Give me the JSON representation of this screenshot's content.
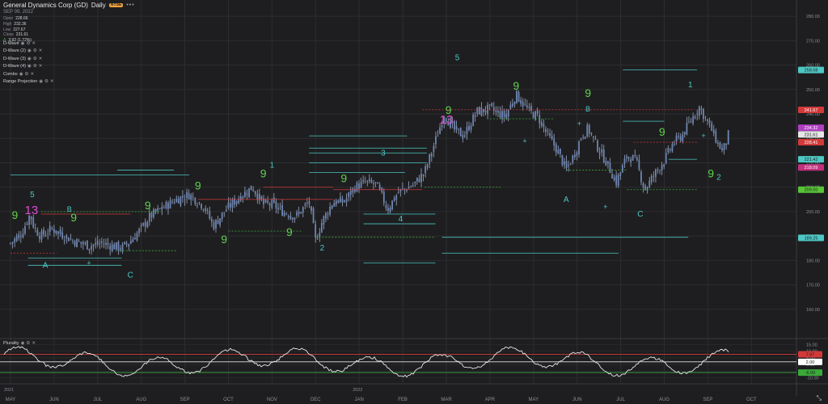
{
  "header": {
    "title": "General Dynamics Corp (GD)",
    "interval": "Daily",
    "badge": "NYSE",
    "date": "SEP 09, 2022",
    "open_label": "Open",
    "open": "228.66",
    "high_label": "High",
    "high": "232.36",
    "low_label": "Low",
    "low": "227.67",
    "close_label": "Close",
    "close": "231.61",
    "change_label": "Δ",
    "change": "3.92 (1.72%)"
  },
  "studies": [
    {
      "label": "D-Wave"
    },
    {
      "label": "D-Wave (2)"
    },
    {
      "label": "D-Wave (3)"
    },
    {
      "label": "D-Wave (4)"
    },
    {
      "label": "Combo"
    },
    {
      "label": "Range Projection"
    }
  ],
  "lower_panel": {
    "label": "Plurality"
  },
  "colors": {
    "background": "#1e1e20",
    "grid": "#2c2d31",
    "candle": "#6e86b3",
    "wick": "#9aa7c2",
    "nine": "#5fd24d",
    "thirteen": "#e04bd6",
    "wave": "#4dc7c4",
    "red_line": "#d23a3a",
    "green_line": "#3aaa3a",
    "osc": "#e6e6e6"
  },
  "chart_data": [
    {
      "type": "candlestick",
      "title": "General Dynamics Corp (GD) Daily",
      "x_ticks": [
        "MAY",
        "JUN",
        "JUL",
        "AUG",
        "SEP",
        "OCT",
        "NOV",
        "DEC",
        "JAN",
        "FEB",
        "MAR",
        "APR",
        "MAY",
        "JUN",
        "JUL",
        "AUG",
        "SEP",
        "OCT"
      ],
      "year_labels": [
        {
          "at": "MAY",
          "text": "2021"
        },
        {
          "at": "JAN",
          "text": "2022"
        }
      ],
      "ylim": [
        150,
        285
      ],
      "y_ticks": [
        280,
        270,
        260,
        250,
        240,
        230,
        220,
        210,
        200,
        190,
        180,
        170,
        160
      ],
      "close_path": [
        {
          "m": 0.0,
          "v": 187
        },
        {
          "m": 0.25,
          "v": 191
        },
        {
          "m": 0.45,
          "v": 199
        },
        {
          "m": 0.55,
          "v": 193
        },
        {
          "m": 0.7,
          "v": 190
        },
        {
          "m": 0.95,
          "v": 193
        },
        {
          "m": 1.15,
          "v": 191
        },
        {
          "m": 1.45,
          "v": 188
        },
        {
          "m": 1.8,
          "v": 186
        },
        {
          "m": 2.1,
          "v": 187
        },
        {
          "m": 2.55,
          "v": 185
        },
        {
          "m": 2.75,
          "v": 188
        },
        {
          "m": 3.0,
          "v": 193
        },
        {
          "m": 3.2,
          "v": 198
        },
        {
          "m": 3.45,
          "v": 201
        },
        {
          "m": 3.8,
          "v": 205
        },
        {
          "m": 4.1,
          "v": 207
        },
        {
          "m": 4.45,
          "v": 202
        },
        {
          "m": 4.65,
          "v": 194
        },
        {
          "m": 4.95,
          "v": 201
        },
        {
          "m": 5.25,
          "v": 206
        },
        {
          "m": 5.55,
          "v": 210
        },
        {
          "m": 5.8,
          "v": 203
        },
        {
          "m": 6.0,
          "v": 203
        },
        {
          "m": 6.25,
          "v": 200
        },
        {
          "m": 6.55,
          "v": 198
        },
        {
          "m": 6.85,
          "v": 204
        },
        {
          "m": 7.0,
          "v": 188
        },
        {
          "m": 7.15,
          "v": 196
        },
        {
          "m": 7.4,
          "v": 204
        },
        {
          "m": 7.65,
          "v": 204
        },
        {
          "m": 7.9,
          "v": 210
        },
        {
          "m": 8.15,
          "v": 212
        },
        {
          "m": 8.4,
          "v": 211
        },
        {
          "m": 8.65,
          "v": 201
        },
        {
          "m": 8.9,
          "v": 208
        },
        {
          "m": 9.25,
          "v": 211
        },
        {
          "m": 9.5,
          "v": 216
        },
        {
          "m": 9.75,
          "v": 229
        },
        {
          "m": 9.95,
          "v": 240
        },
        {
          "m": 10.15,
          "v": 234
        },
        {
          "m": 10.4,
          "v": 231
        },
        {
          "m": 10.7,
          "v": 241
        },
        {
          "m": 11.0,
          "v": 242
        },
        {
          "m": 11.35,
          "v": 239
        },
        {
          "m": 11.6,
          "v": 248
        },
        {
          "m": 11.9,
          "v": 241
        },
        {
          "m": 12.1,
          "v": 239
        },
        {
          "m": 12.3,
          "v": 232
        },
        {
          "m": 12.55,
          "v": 225
        },
        {
          "m": 12.75,
          "v": 217
        },
        {
          "m": 12.95,
          "v": 224
        },
        {
          "m": 13.1,
          "v": 231
        },
        {
          "m": 13.25,
          "v": 234
        },
        {
          "m": 13.45,
          "v": 227
        },
        {
          "m": 13.65,
          "v": 221
        },
        {
          "m": 13.9,
          "v": 212
        },
        {
          "m": 14.15,
          "v": 223
        },
        {
          "m": 14.35,
          "v": 221
        },
        {
          "m": 14.55,
          "v": 209
        },
        {
          "m": 14.8,
          "v": 216
        },
        {
          "m": 15.0,
          "v": 221
        },
        {
          "m": 15.2,
          "v": 228
        },
        {
          "m": 15.4,
          "v": 231
        },
        {
          "m": 15.6,
          "v": 237
        },
        {
          "m": 15.8,
          "v": 243
        },
        {
          "m": 15.95,
          "v": 238
        },
        {
          "m": 16.1,
          "v": 233
        },
        {
          "m": 16.25,
          "v": 227
        },
        {
          "m": 16.35,
          "v": 225
        },
        {
          "m": 16.48,
          "v": 232
        }
      ],
      "price_labels": [
        {
          "text": "258.08",
          "v": 258,
          "color": "#4dc7c4"
        },
        {
          "text": "241.67",
          "v": 241.67,
          "color": "#d23a3a"
        },
        {
          "text": "234.32",
          "v": 234.32,
          "color": "#b13fc4"
        },
        {
          "text": "231.61",
          "v": 231.61,
          "color": "#e6e6e6"
        },
        {
          "text": "228.41",
          "v": 228.41,
          "color": "#d23a3a"
        },
        {
          "text": "221.42",
          "v": 221.42,
          "color": "#4dc7c4"
        },
        {
          "text": "218.09",
          "v": 218.09,
          "color": "#c2307e"
        },
        {
          "text": "209.00",
          "v": 209,
          "color": "#58c437"
        },
        {
          "text": "189.25",
          "v": 189.25,
          "color": "#4dc7c4"
        }
      ],
      "levels": [
        {
          "from": 0.0,
          "to": 4.1,
          "v": 215,
          "color": "#4dc7c4"
        },
        {
          "from": 2.45,
          "to": 3.75,
          "v": 217,
          "color": "#4dc7c4"
        },
        {
          "from": 6.85,
          "to": 9.05,
          "v": 216,
          "color": "#4dc7c4"
        },
        {
          "from": 6.85,
          "to": 9.55,
          "v": 220,
          "color": "#4dc7c4"
        },
        {
          "from": 6.85,
          "to": 9.55,
          "v": 224,
          "color": "#4dc7c4"
        },
        {
          "from": 6.85,
          "to": 9.55,
          "v": 226,
          "color": "#4dc7c4"
        },
        {
          "from": 6.85,
          "to": 9.1,
          "v": 231,
          "color": "#4dc7c4"
        },
        {
          "from": 8.1,
          "to": 9.75,
          "v": 199,
          "color": "#4dc7c4"
        },
        {
          "from": 8.1,
          "to": 9.75,
          "v": 195,
          "color": "#4dc7c4"
        },
        {
          "from": 8.1,
          "to": 9.75,
          "v": 179,
          "color": "#4dc7c4"
        },
        {
          "from": 9.9,
          "to": 15.55,
          "v": 189.5,
          "color": "#4dc7c4"
        },
        {
          "from": 9.9,
          "to": 13.95,
          "v": 183,
          "color": "#4dc7c4"
        },
        {
          "from": 14.05,
          "to": 15.75,
          "v": 258,
          "color": "#4dc7c4"
        },
        {
          "from": 14.05,
          "to": 15.0,
          "v": 237,
          "color": "#4dc7c4"
        },
        {
          "from": 0.4,
          "to": 2.55,
          "v": 181,
          "color": "#4dc7c4"
        },
        {
          "from": 0.4,
          "to": 2.55,
          "v": 178,
          "color": "#4dc7c4"
        },
        {
          "from": 15.1,
          "to": 15.75,
          "v": 221.4,
          "color": "#4dc7c4"
        },
        {
          "from": 0.7,
          "to": 2.75,
          "v": 199,
          "color": "#d23a3a"
        },
        {
          "from": 4.3,
          "to": 7.4,
          "v": 205,
          "color": "#d23a3a"
        },
        {
          "from": 5.8,
          "to": 7.4,
          "v": 210,
          "color": "#d23a3a"
        },
        {
          "from": 7.4,
          "to": 9.45,
          "v": 209,
          "color": "#d23a3a"
        },
        {
          "from": 9.45,
          "to": 15.7,
          "v": 241.7,
          "color": "#d23a3a",
          "dash": true
        },
        {
          "from": 14.3,
          "to": 15.75,
          "v": 228.4,
          "color": "#d23a3a",
          "dash": true
        },
        {
          "from": 0.0,
          "to": 1.05,
          "v": 183,
          "color": "#d23a3a",
          "dash": true
        },
        {
          "from": 2.5,
          "to": 3.8,
          "v": 184,
          "color": "#3aaa3a",
          "dash": true
        },
        {
          "from": 5.0,
          "to": 6.7,
          "v": 192,
          "color": "#3aaa3a",
          "dash": true
        },
        {
          "from": 7.0,
          "to": 9.75,
          "v": 189.5,
          "color": "#3aaa3a",
          "dash": true
        },
        {
          "from": 9.5,
          "to": 11.25,
          "v": 210,
          "color": "#3aaa3a",
          "dash": true
        },
        {
          "from": 11.0,
          "to": 12.45,
          "v": 238,
          "color": "#3aaa3a",
          "dash": true
        },
        {
          "from": 12.75,
          "to": 14.15,
          "v": 217,
          "color": "#3aaa3a",
          "dash": true
        },
        {
          "from": 14.15,
          "to": 15.75,
          "v": 209,
          "color": "#3aaa3a",
          "dash": true
        },
        {
          "from": 0.7,
          "to": 3.5,
          "v": 200,
          "color": "#3aaa3a",
          "dash": true
        }
      ],
      "markers": [
        {
          "text": "9",
          "m": 0.1,
          "v": 197,
          "color": "#5fd24d",
          "size": 14
        },
        {
          "text": "13",
          "m": 0.48,
          "v": 199,
          "color": "#e04bd6",
          "size": 15
        },
        {
          "text": "5",
          "m": 0.5,
          "v": 206,
          "color": "#4dc7c4",
          "size": 10
        },
        {
          "text": "B",
          "m": 1.35,
          "v": 200,
          "color": "#4dc7c4",
          "size": 9
        },
        {
          "text": "9",
          "m": 1.45,
          "v": 196,
          "color": "#5fd24d",
          "size": 14
        },
        {
          "text": "A",
          "m": 0.8,
          "v": 177,
          "color": "#4dc7c4",
          "size": 10
        },
        {
          "text": "+",
          "m": 1.8,
          "v": 178,
          "color": "#4dc7c4",
          "size": 9
        },
        {
          "text": "C",
          "m": 2.75,
          "v": 173,
          "color": "#4dc7c4",
          "size": 10
        },
        {
          "text": "9",
          "m": 3.15,
          "v": 201,
          "color": "#5fd24d",
          "size": 14
        },
        {
          "text": "9",
          "m": 4.3,
          "v": 209,
          "color": "#5fd24d",
          "size": 14
        },
        {
          "text": "9",
          "m": 4.9,
          "v": 187,
          "color": "#5fd24d",
          "size": 14
        },
        {
          "text": "9",
          "m": 5.8,
          "v": 214,
          "color": "#5fd24d",
          "size": 14
        },
        {
          "text": "1",
          "m": 6.0,
          "v": 218,
          "color": "#4dc7c4",
          "size": 10
        },
        {
          "text": "9",
          "m": 6.4,
          "v": 190,
          "color": "#5fd24d",
          "size": 14
        },
        {
          "text": "2",
          "m": 7.15,
          "v": 184,
          "color": "#4dc7c4",
          "size": 10
        },
        {
          "text": "9",
          "m": 7.65,
          "v": 212,
          "color": "#5fd24d",
          "size": 14
        },
        {
          "text": "3",
          "m": 8.55,
          "v": 223,
          "color": "#4dc7c4",
          "size": 10
        },
        {
          "text": "4",
          "m": 8.95,
          "v": 196,
          "color": "#4dc7c4",
          "size": 10
        },
        {
          "text": "9",
          "m": 10.05,
          "v": 240,
          "color": "#5fd24d",
          "size": 14
        },
        {
          "text": "13",
          "m": 10.0,
          "v": 236,
          "color": "#e04bd6",
          "size": 15
        },
        {
          "text": "5",
          "m": 10.25,
          "v": 262,
          "color": "#4dc7c4",
          "size": 10
        },
        {
          "text": "9",
          "m": 11.6,
          "v": 250,
          "color": "#5fd24d",
          "size": 14
        },
        {
          "text": "+",
          "m": 11.8,
          "v": 228,
          "color": "#4dc7c4",
          "size": 9
        },
        {
          "text": "9",
          "m": 13.25,
          "v": 247,
          "color": "#5fd24d",
          "size": 14
        },
        {
          "text": "B",
          "m": 13.25,
          "v": 241,
          "color": "#4dc7c4",
          "size": 9
        },
        {
          "text": "+",
          "m": 13.05,
          "v": 235,
          "color": "#4dc7c4",
          "size": 9
        },
        {
          "text": "A",
          "m": 12.75,
          "v": 204,
          "color": "#4dc7c4",
          "size": 10
        },
        {
          "text": "+",
          "m": 13.65,
          "v": 201,
          "color": "#4dc7c4",
          "size": 9
        },
        {
          "text": "C",
          "m": 14.45,
          "v": 198,
          "color": "#4dc7c4",
          "size": 10
        },
        {
          "text": "9",
          "m": 14.95,
          "v": 231,
          "color": "#5fd24d",
          "size": 14
        },
        {
          "text": "1",
          "m": 15.6,
          "v": 251,
          "color": "#4dc7c4",
          "size": 10
        },
        {
          "text": "+",
          "m": 15.9,
          "v": 230,
          "color": "#4dc7c4",
          "size": 9
        },
        {
          "text": "9",
          "m": 16.07,
          "v": 214,
          "color": "#5fd24d",
          "size": 14
        },
        {
          "text": "2",
          "m": 16.25,
          "v": 213,
          "color": "#4dc7c4",
          "size": 10
        }
      ]
    },
    {
      "type": "line",
      "title": "Plurality",
      "ylim": [
        -12,
        17
      ],
      "y_ticks": [
        15,
        10,
        5,
        0,
        -5,
        -10
      ],
      "y_tick_labels": [
        "15.00",
        "10.00",
        "5.00",
        "0.00",
        "-5.00",
        "-10.00"
      ],
      "levels": [
        {
          "v": 7.6,
          "color": "#d23a3a",
          "label": "7.6?"
        },
        {
          "v": 2.0,
          "color": "#e6e6e6",
          "label": "2.00"
        },
        {
          "v": -6.0,
          "color": "#3aaa3a",
          "label": "-6.00"
        }
      ]
    }
  ]
}
